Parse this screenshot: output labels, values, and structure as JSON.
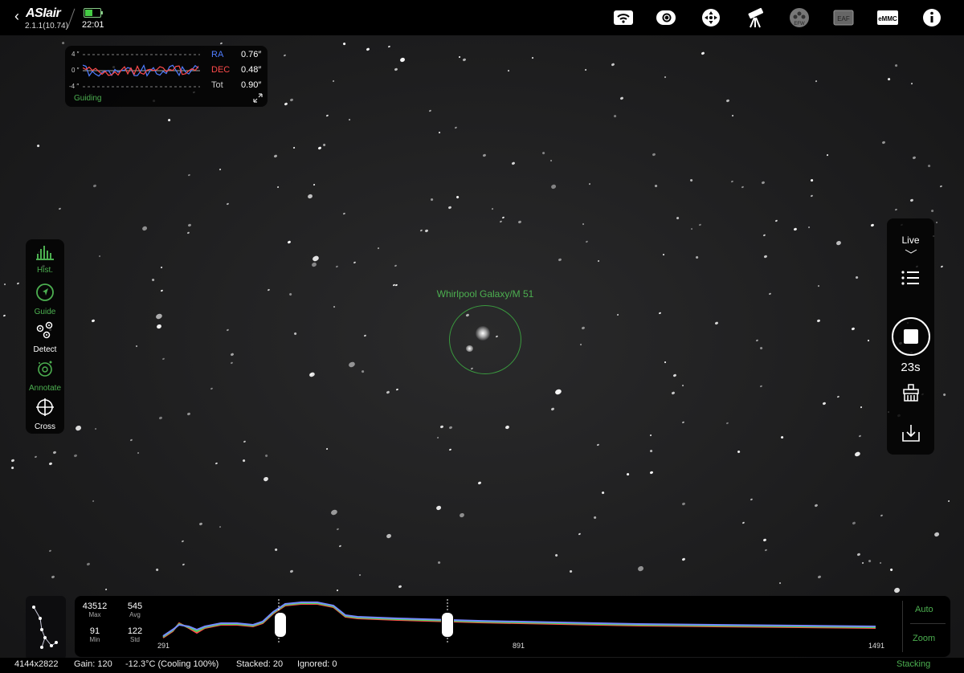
{
  "header": {
    "logo": "ASIair",
    "version": "2.1.1(10.74)",
    "time": "22:01",
    "battery_level": 0.5,
    "icons": [
      "wifi-icon",
      "camera-icon",
      "mount-control-icon",
      "telescope-icon",
      "efw-icon",
      "eaf-icon",
      "emmc-icon",
      "info-icon"
    ],
    "efw_label": "EFW",
    "eaf_label": "EAF",
    "emmc_label": "eMMC"
  },
  "guiding": {
    "axis_top": "4 ″",
    "axis_mid": "0 ″",
    "axis_bottom": "-4 ″",
    "ra_label": "RA",
    "ra_value": "0.76″",
    "dec_label": "DEC",
    "dec_value": "0.48″",
    "tot_label": "Tot",
    "tot_value": "0.90″",
    "status": "Guiding",
    "colors": {
      "ra": "#4f7dff",
      "dec": "#ff4b4b",
      "status": "#4caf50"
    }
  },
  "left_tools": [
    {
      "label": "Hist.",
      "icon": "histogram-icon",
      "active": true
    },
    {
      "label": "Guide",
      "icon": "guide-icon",
      "active": true
    },
    {
      "label": "Detect",
      "icon": "detect-icon",
      "active": false
    },
    {
      "label": "Annotate",
      "icon": "annotate-icon",
      "active": true
    },
    {
      "label": "Cross",
      "icon": "crosshair-icon",
      "active": false
    }
  ],
  "right_panel": {
    "mode": "Live",
    "timer": "23s",
    "icons": [
      "list-icon",
      "stop-icon",
      "clear-icon",
      "save-icon"
    ]
  },
  "annotation": {
    "label": "Whirlpool Galaxy/M 51"
  },
  "histogram": {
    "max_value": "43512",
    "max_label": "Max",
    "avg_value": "545",
    "avg_label": "Avg",
    "min_value": "91",
    "min_label": "Min",
    "std_value": "122",
    "std_label": "Std",
    "tick_left": "291",
    "tick_mid": "891",
    "tick_right": "1491",
    "auto_label": "Auto",
    "zoom_label": "Zoom"
  },
  "status": {
    "resolution": "4144x2822",
    "gain": "Gain: 120",
    "temperature": "-12.3°C (Cooling 100%)",
    "stacked": "Stacked: 20",
    "ignored": "Ignored: 0",
    "mode": "Stacking"
  }
}
